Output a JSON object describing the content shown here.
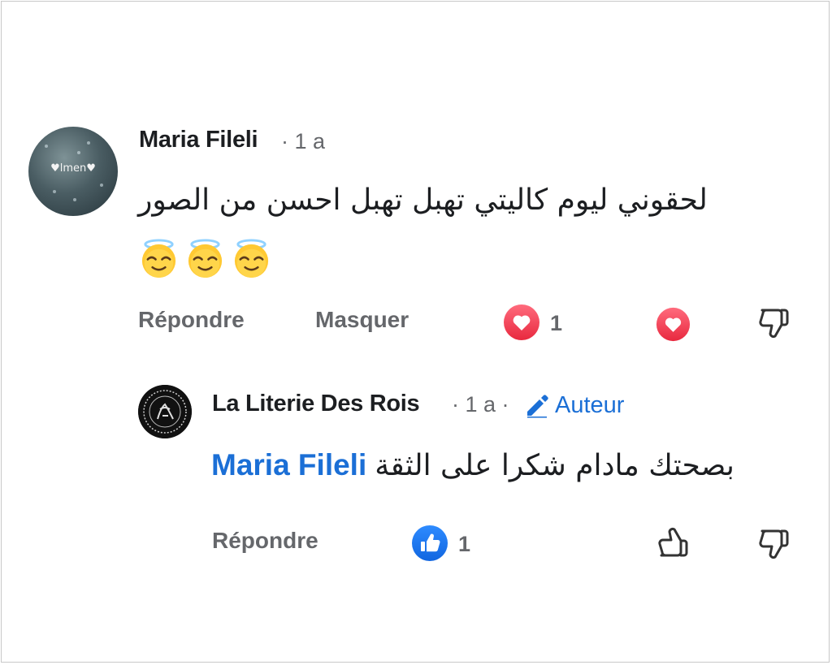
{
  "main_comment": {
    "author": "Maria Fileli",
    "meta": "· 1 a",
    "avatar_text": "♥lmen♥",
    "text": "لحقوني ليوم كاليتي تهبل تهبل احسن من الصور",
    "emoji_icons": [
      "smiling-face-with-halo-icon",
      "smiling-face-with-halo-icon",
      "smiling-face-with-halo-icon"
    ],
    "reply_label": "Répondre",
    "hide_label": "Masquer",
    "reaction_count": "1"
  },
  "reply": {
    "author": "La Literie Des Rois",
    "meta": "· 1 a ·",
    "author_badge": "Auteur",
    "mention": "Maria Fileli",
    "text": "بصحتك مادام شكرا على الثقة",
    "reply_label": "Répondre",
    "reaction_count": "1"
  },
  "colors": {
    "text": "#1c1e21",
    "secondary": "#65676b",
    "link_blue": "#1b6fd6",
    "love_red": "#f0435a",
    "like_blue": "#1877f2"
  }
}
